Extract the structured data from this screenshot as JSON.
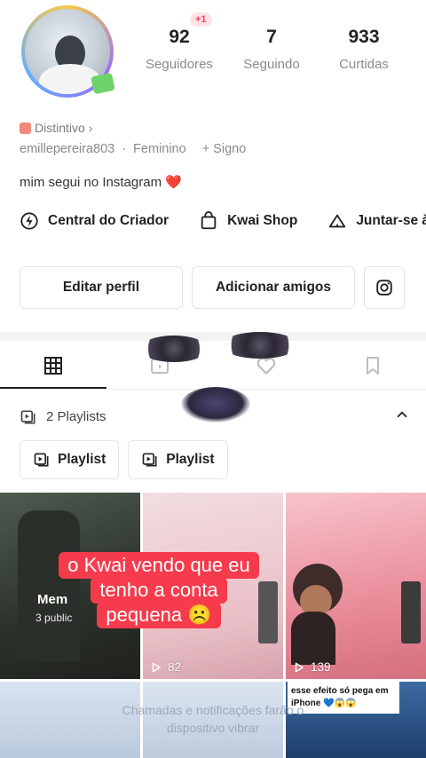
{
  "profile": {
    "stats": [
      {
        "value": "92",
        "label": "Seguidores",
        "badge": "+1"
      },
      {
        "value": "7",
        "label": "Seguindo"
      },
      {
        "value": "933",
        "label": "Curtidas"
      }
    ],
    "distintivo": "Distintivo",
    "distintivo_chevron": "›",
    "username": "emillepereira803",
    "gender": "Feminino",
    "sign": "+ Signo",
    "separator": "·",
    "bio": "mim segui no Instagram",
    "bio_emoji": "❤️"
  },
  "links": [
    {
      "label": "Central do Criador",
      "icon": "bolt-icon"
    },
    {
      "label": "Kwai Shop",
      "icon": "shopping-bag-icon"
    },
    {
      "label": "Juntar-se à",
      "icon": "tent-icon"
    }
  ],
  "buttons": {
    "edit": "Editar perfil",
    "add": "Adicionar amigos",
    "instagram_icon": "instagram-icon"
  },
  "tabs": [
    {
      "name": "grid",
      "icon": "grid-icon",
      "active": true
    },
    {
      "name": "private",
      "icon": "lock-box-icon"
    },
    {
      "name": "likes",
      "icon": "heart-icon"
    },
    {
      "name": "saved",
      "icon": "bookmark-icon"
    }
  ],
  "playlists": {
    "title": "2 Playlists",
    "chevron": "^",
    "chips": [
      "Playlist",
      "Playlist"
    ]
  },
  "grid": {
    "memories_title": "Mem",
    "memories_sub": "3 public",
    "views_1": "82",
    "views_2": "139",
    "note": "esse efeito só pega em iPhone 💙😱😱"
  },
  "meme": {
    "lines": [
      "o Kwai vendo que eu",
      "tenho a conta",
      "pequena ☹️"
    ]
  },
  "bottom_caption": {
    "line1": "Chamadas e notificações farão o",
    "line2": "dispositivo vibrar"
  }
}
